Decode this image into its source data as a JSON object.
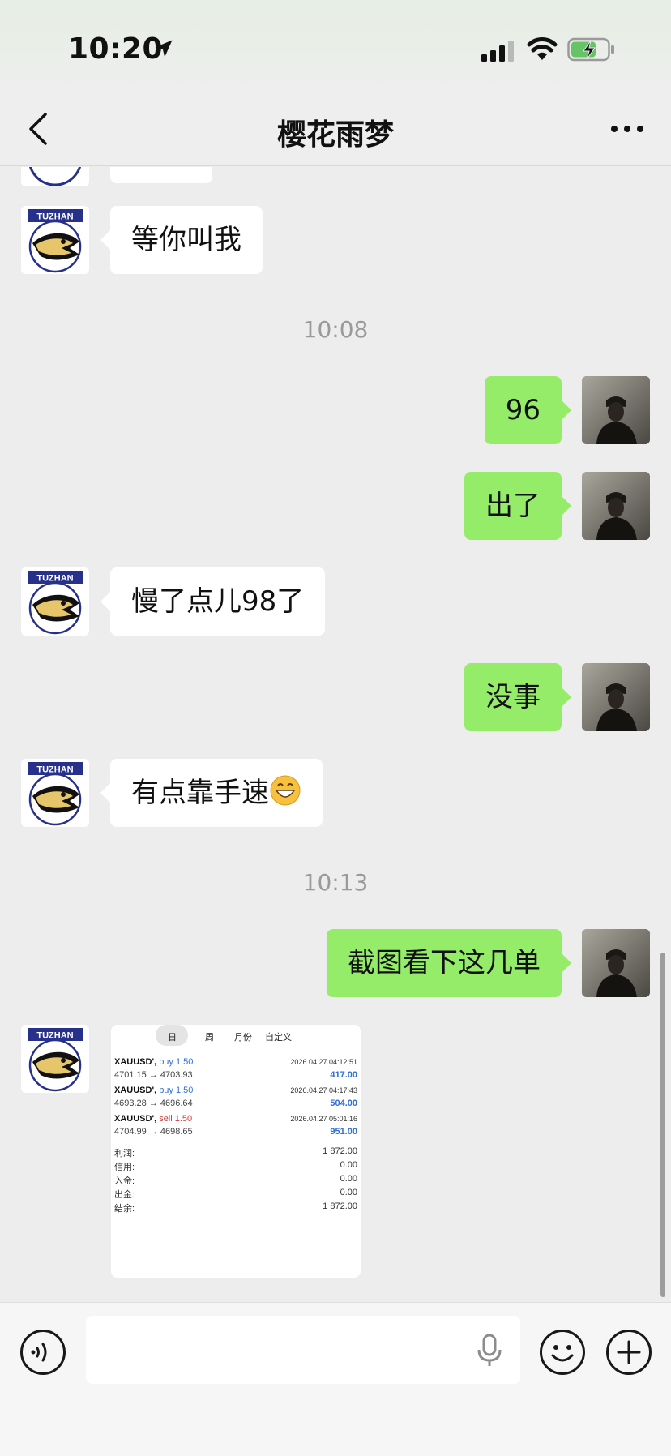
{
  "status_bar": {
    "time": "10:20",
    "icons": [
      "location-arrow-icon",
      "cellular-signal-icon",
      "wifi-icon",
      "battery-charging-icon"
    ],
    "battery_color": "#65c466"
  },
  "nav": {
    "title": "樱花雨梦",
    "back_icon": "chevron-left-icon",
    "more_icon": "ellipsis-icon"
  },
  "contact_avatar": {
    "label": "TUZHAN",
    "label_bg": "#27308a"
  },
  "messages": [
    {
      "side": "in",
      "text": "等你叫我"
    },
    {
      "type": "timestamp",
      "text": "10:08"
    },
    {
      "side": "out",
      "text": "96"
    },
    {
      "side": "out",
      "text": "出了"
    },
    {
      "side": "in",
      "text": "慢了点儿98了"
    },
    {
      "side": "out",
      "text": "没事"
    },
    {
      "side": "in",
      "text": "有点靠手速",
      "emoji": "grinning-face-emoji"
    },
    {
      "type": "timestamp",
      "text": "10:13"
    },
    {
      "side": "out",
      "text": "截图看下这几单"
    }
  ],
  "image_message": {
    "tabs": [
      "日",
      "周",
      "月份",
      "自定义"
    ],
    "trades": [
      {
        "symbol": "XAUUSD',",
        "side": "buy 1.50",
        "side_color": "#2f6fd6",
        "time": "2026.04.27 04:12:51",
        "price": "4701.15 → 4703.93",
        "profit": "417.00"
      },
      {
        "symbol": "XAUUSD',",
        "side": "buy 1.50",
        "side_color": "#2f6fd6",
        "time": "2026.04.27 04:17:43",
        "price": "4693.28 → 4696.64",
        "profit": "504.00"
      },
      {
        "symbol": "XAUUSD',",
        "side": "sell 1.50",
        "side_color": "#d23b3b",
        "time": "2026.04.27 05:01:16",
        "price": "4704.99 → 4698.65",
        "profit": "951.00"
      }
    ],
    "summary": [
      {
        "label": "利润:",
        "value": "1 872.00"
      },
      {
        "label": "信用:",
        "value": "0.00"
      },
      {
        "label": "入金:",
        "value": "0.00"
      },
      {
        "label": "出金:",
        "value": "0.00"
      },
      {
        "label": "结余:",
        "value": "1 872.00"
      }
    ]
  },
  "input_bar": {
    "voice_icon": "voice-mode-icon",
    "placeholder": "",
    "mic_icon": "microphone-icon",
    "emoji_icon": "smiley-icon",
    "plus_icon": "plus-circle-icon"
  },
  "colors": {
    "outgoing_bubble": "#95ec69",
    "incoming_bubble": "#ffffff",
    "background": "#ededed"
  }
}
